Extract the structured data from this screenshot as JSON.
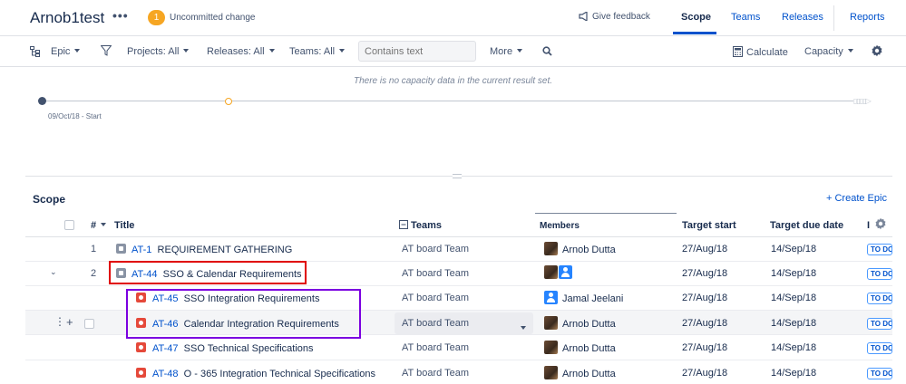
{
  "header": {
    "title": "Arnob1test",
    "more": "•••",
    "badge_count": "1",
    "uncommitted": "Uncommitted change",
    "feedback": "Give feedback",
    "tabs": [
      {
        "label": "Scope",
        "active": true
      },
      {
        "label": "Teams",
        "active": false
      },
      {
        "label": "Releases",
        "active": false
      },
      {
        "label": "Reports",
        "active": false
      }
    ]
  },
  "toolbar": {
    "hierarchy": "Epic",
    "projects": "Projects: All",
    "releases": "Releases: All",
    "teams": "Teams: All",
    "search_placeholder": "Contains text",
    "more": "More",
    "calculate": "Calculate",
    "capacity": "Capacity"
  },
  "timeline": {
    "no_capacity": "There is no capacity data in the current result set.",
    "start_label": "09/Oct/18 - Start"
  },
  "scope": {
    "heading": "Scope",
    "create_epic": "+ Create Epic",
    "columns": {
      "num": "#",
      "title": "Title",
      "teams": "Teams",
      "members": "Members",
      "target_start": "Target start",
      "target_due": "Target due date",
      "status": "I"
    },
    "rows": [
      {
        "num": "1",
        "key": "AT-1",
        "title": "REQUIREMENT GATHERING",
        "type": "epic",
        "team": "AT board Team",
        "members": "Arnob Dutta",
        "avatars": [
          "photo"
        ],
        "start": "27/Aug/18",
        "due": "14/Sep/18",
        "status": "TO DO"
      },
      {
        "num": "2",
        "key": "AT-44",
        "title": "SSO & Calendar Requirements",
        "type": "epic",
        "team": "AT board Team",
        "members": "",
        "avatars": [
          "photo",
          "user"
        ],
        "start": "27/Aug/18",
        "due": "14/Sep/18",
        "status": "TO DO"
      },
      {
        "num": "",
        "key": "AT-45",
        "title": "SSO Integration Requirements",
        "type": "story",
        "team": "AT board Team",
        "members": "Jamal Jeelani",
        "avatars": [
          "user"
        ],
        "start": "27/Aug/18",
        "due": "14/Sep/18",
        "status": "TO DO"
      },
      {
        "num": "",
        "key": "AT-46",
        "title": "Calendar Integration Requirements",
        "type": "story",
        "team": "AT board Team",
        "members": "Arnob Dutta",
        "avatars": [
          "photo"
        ],
        "start": "27/Aug/18",
        "due": "14/Sep/18",
        "status": "TO DO"
      },
      {
        "num": "",
        "key": "AT-47",
        "title": "SSO Technical Specifications",
        "type": "story",
        "team": "AT board Team",
        "members": "Arnob Dutta",
        "avatars": [
          "photo"
        ],
        "start": "27/Aug/18",
        "due": "14/Sep/18",
        "status": "TO DO"
      },
      {
        "num": "",
        "key": "AT-48",
        "title": "O - 365 Integration Technical Specifications",
        "type": "story",
        "team": "AT board Team",
        "members": "Arnob Dutta",
        "avatars": [
          "photo"
        ],
        "start": "27/Aug/18",
        "due": "14/Sep/18",
        "status": "TO DO"
      }
    ]
  }
}
